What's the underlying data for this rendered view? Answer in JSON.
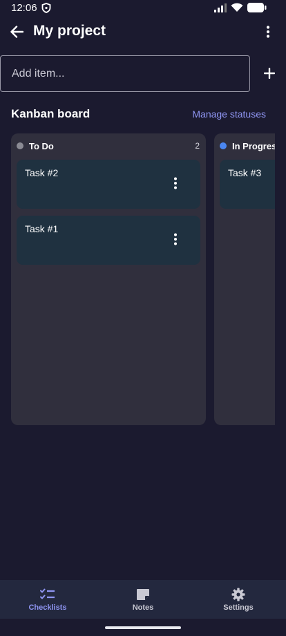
{
  "status_bar": {
    "time": "12:06",
    "icons": [
      "shield-icon",
      "signal-icon",
      "wifi-icon",
      "battery-icon"
    ]
  },
  "app_bar": {
    "title": "My project",
    "back_icon": "arrow-back-icon",
    "menu_icon": "more-vert-icon"
  },
  "add_item": {
    "placeholder": "Add item...",
    "value": "",
    "add_icon": "plus-icon"
  },
  "board": {
    "title": "Kanban board",
    "manage_label": "Manage statuses",
    "columns": [
      {
        "name": "To Do",
        "count": "2",
        "dot_color": "#8a8a93",
        "cards": [
          {
            "title": "Task #2"
          },
          {
            "title": "Task #1"
          }
        ]
      },
      {
        "name": "In Progress",
        "count": "",
        "dot_color": "#4a86f0",
        "cards": [
          {
            "title": "Task #3"
          }
        ]
      }
    ]
  },
  "bottom_nav": {
    "items": [
      {
        "label": "Checklists",
        "icon": "checklist-icon",
        "active": true
      },
      {
        "label": "Notes",
        "icon": "note-icon",
        "active": false
      },
      {
        "label": "Settings",
        "icon": "gear-icon",
        "active": false
      }
    ]
  },
  "colors": {
    "background": "#1b1a2f",
    "accent": "#8f95f2",
    "column": "#302f3d",
    "card": "#1f3140",
    "nav": "#23283e"
  }
}
